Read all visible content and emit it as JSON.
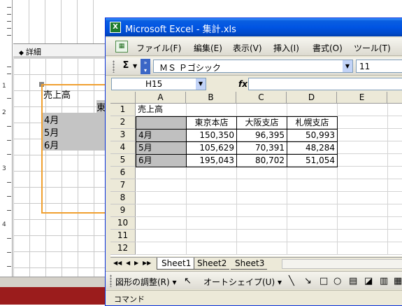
{
  "designer": {
    "section_label": "詳細",
    "ruler_numbers": [
      "1",
      "2",
      "3",
      "4"
    ],
    "title_label": "売上高",
    "col_head_partial": "東",
    "row_labels": [
      "4月",
      "5月",
      "6月"
    ]
  },
  "excel": {
    "title": "Microsoft Excel - 集計.xls",
    "app_icon_glyph": "X",
    "menu": [
      "ファイル(F)",
      "編集(E)",
      "表示(V)",
      "挿入(I)",
      "書式(O)",
      "ツール(T)"
    ],
    "toolbar": {
      "sigma": "Σ",
      "font_name": "ＭＳ Ｐゴシック",
      "font_size": "11"
    },
    "name_box": "H15",
    "fx_label": "fx",
    "columns": [
      "A",
      "B",
      "C",
      "D",
      "E"
    ],
    "rows": [
      "1",
      "2",
      "3",
      "4",
      "5",
      "6",
      "7",
      "8",
      "9",
      "10",
      "11",
      "12"
    ],
    "cells": {
      "a1": "売上高",
      "headers": [
        "東京本店",
        "大阪支店",
        "札幌支店"
      ],
      "data": [
        {
          "label": "4月",
          "values": [
            "150,350",
            "96,395",
            "50,993"
          ]
        },
        {
          "label": "5月",
          "values": [
            "105,629",
            "70,391",
            "48,284"
          ]
        },
        {
          "label": "6月",
          "values": [
            "195,043",
            "80,702",
            "51,054"
          ]
        }
      ]
    },
    "sheet_tabs": [
      "Sheet1",
      "Sheet2",
      "Sheet3"
    ],
    "tab_nav": [
      "◀◀",
      "◀",
      "▶",
      "▶▶"
    ],
    "drawing": {
      "adjust": "図形の調整(R)",
      "autoshape": "オートシェイプ(U)"
    },
    "status": "コマンド"
  }
}
